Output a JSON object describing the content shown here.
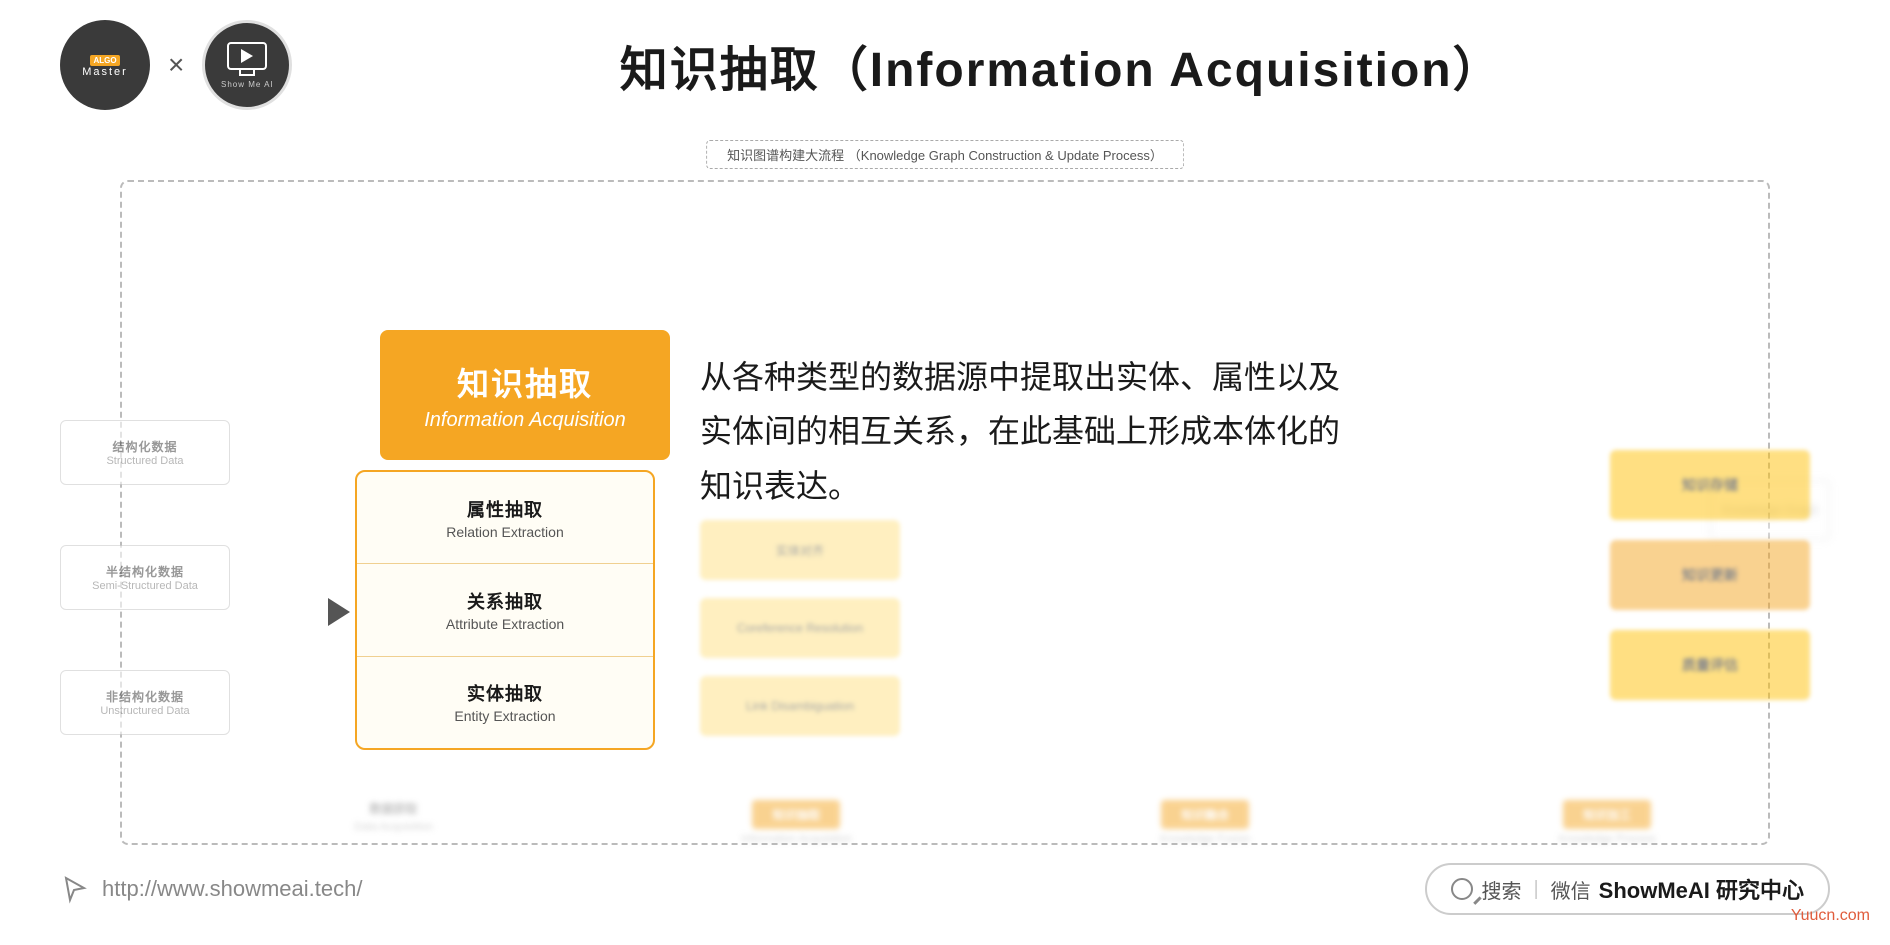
{
  "header": {
    "title": "知识抽取（Information Acquisition）",
    "algo_logo": {
      "line1": "ALGO",
      "line2": "Master"
    },
    "x_separator": "×",
    "showme_logo": {
      "label": "Show Me AI"
    }
  },
  "highlight_box": {
    "title": "知识抽取",
    "subtitle": "Information Acquisition"
  },
  "inner_items": [
    {
      "title": "属性抽取",
      "subtitle": "Relation Extraction"
    },
    {
      "title": "关系抽取",
      "subtitle": "Attribute Extraction"
    },
    {
      "title": "实体抽取",
      "subtitle": "Entity Extraction"
    }
  ],
  "description": {
    "text": "从各种类型的数据源中提取出实体、属性以及实体间的相互关系，在此基础上形成本体化的知识表达。"
  },
  "data_sources": [
    {
      "title": "结构化数据",
      "sub": "Structured Data"
    },
    {
      "title": "半结构化数据",
      "sub": "Semi-Structured Data"
    },
    {
      "title": "非结构化数据",
      "sub": "Unstructured Data"
    }
  ],
  "flow_top_label": "知识图谱构建大流程 （Knowledge Graph Construction & Update Process）",
  "search_bar": {
    "icon_label": "搜索",
    "divider": "|",
    "wechat": "微信",
    "brand": "ShowMeAI 研究中心"
  },
  "bottom": {
    "website": "http://www.showmeai.tech/",
    "watermark": "Yuucn.com"
  },
  "blurred_bottom_labels": [
    {
      "title": "数据获取",
      "sub": "Data Acquisition",
      "tag": ""
    },
    {
      "title": "",
      "sub": "Information Acquisition",
      "tag": "orange"
    },
    {
      "title": "",
      "sub": "Knowledge Fusion",
      "tag": "orange"
    },
    {
      "title": "",
      "sub": "",
      "tag": "orange"
    }
  ]
}
